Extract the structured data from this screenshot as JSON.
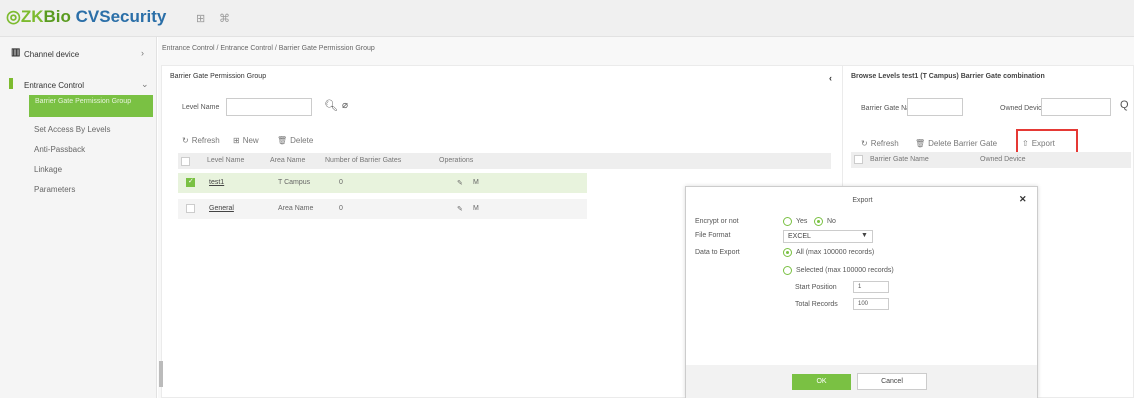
{
  "app": {
    "logo_prefix": "ZK",
    "logo_mid": "Bio",
    "logo_suffix": " CVSecurity",
    "header_icons": [
      "grid-icon",
      "expand-icon"
    ]
  },
  "sidebar": {
    "groups": [
      {
        "label": "Channel device",
        "icon": "device-icon"
      },
      {
        "label": "Entrance Control",
        "icon": "entrance-icon"
      }
    ],
    "items": [
      {
        "label": "Barrier Gate Permission Group"
      },
      {
        "label": "Set Access By Levels"
      },
      {
        "label": "Anti-Passback"
      },
      {
        "label": "Linkage"
      },
      {
        "label": "Parameters"
      }
    ]
  },
  "breadcrumb": "Entrance Control / Entrance Control / Barrier Gate Permission Group",
  "left_panel": {
    "title": "Barrier Gate Permission Group",
    "search_label": "Level Name",
    "toolbar": {
      "refresh": "Refresh",
      "new": "New",
      "delete": "Delete"
    },
    "columns": [
      "Level Name",
      "Area Name",
      "Number of Barrier Gates",
      "Operations"
    ],
    "rows": [
      {
        "level": "test1",
        "area": "T Campus",
        "gates": "0",
        "checked": true
      },
      {
        "level": "General",
        "area": "Area Name",
        "gates": "0",
        "checked": false
      }
    ]
  },
  "right_panel": {
    "title": "Browse Levels test1  (T Campus)  Barrier Gate combination",
    "gate_name_label": "Barrier Gate Name",
    "owned_device_label": "Owned Device",
    "toolbar": {
      "refresh": "Refresh",
      "delete": "Delete Barrier Gate",
      "export": "Export"
    },
    "columns": [
      "Barrier Gate Name",
      "Owned Device"
    ]
  },
  "export_dialog": {
    "title": "Export",
    "encrypt_label": "Encrypt or not",
    "yes": "Yes",
    "no": "No",
    "encrypt_value": "No",
    "format_label": "File Format",
    "format_value": "EXCEL",
    "data_label": "Data to Export",
    "all_option": "All (max 100000 records)",
    "selected_option": "Selected (max 100000 records)",
    "start_label": "Start Position",
    "start_value": "1",
    "total_label": "Total Records",
    "total_value": "100",
    "ok": "OK",
    "cancel": "Cancel"
  },
  "colors": {
    "accent": "#7ac143",
    "highlight": "#e53935"
  }
}
